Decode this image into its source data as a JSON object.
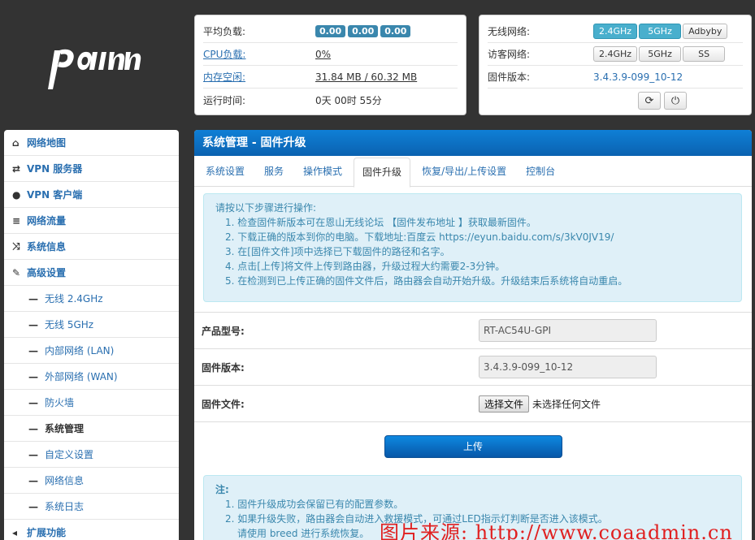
{
  "status": {
    "avg_load_label": "平均负载:",
    "avg_load_values": [
      "0.00",
      "0.00",
      "0.00"
    ],
    "cpu_label": "CPU负载:",
    "cpu_value": "0%",
    "mem_label": "内存空闲:",
    "mem_value": "31.84 MB / 60.32 MB",
    "uptime_label": "运行时间:",
    "uptime_value": "0天 00时 55分"
  },
  "network": {
    "wireless_label": "无线网络:",
    "wireless_buttons": [
      "2.4GHz",
      "5GHz",
      "Adbyby"
    ],
    "guest_label": "访客网络:",
    "guest_buttons": [
      "2.4GHz",
      "5GHz",
      "SS"
    ],
    "fw_label": "固件版本:",
    "fw_value": "3.4.3.9-099_10-12"
  },
  "sidebar": {
    "items": [
      {
        "label": "网络地图",
        "icon": "home-icon",
        "glyph": "⌂"
      },
      {
        "label": "VPN 服务器",
        "icon": "retweet-icon",
        "glyph": "⇄"
      },
      {
        "label": "VPN 客户端",
        "icon": "globe-icon",
        "glyph": "●"
      },
      {
        "label": "网络流量",
        "icon": "list-icon",
        "glyph": "≡"
      },
      {
        "label": "系统信息",
        "icon": "random-icon",
        "glyph": "⤨"
      },
      {
        "label": "高级设置",
        "icon": "wrench-icon",
        "glyph": "✎"
      }
    ],
    "sub_items": [
      "无线 2.4GHz",
      "无线 5GHz",
      "内部网络 (LAN)",
      "外部网络 (WAN)",
      "防火墙",
      "系统管理",
      "自定义设置",
      "网络信息",
      "系统日志"
    ],
    "last_item": {
      "label": "扩展功能",
      "icon": "share-icon",
      "glyph": "◂"
    }
  },
  "main": {
    "title": "系统管理 - 固件升级",
    "tabs": [
      "系统设置",
      "服务",
      "操作模式",
      "固件升级",
      "恢复/导出/上传设置",
      "控制台"
    ],
    "info_intro": "请按以下步骤进行操作:",
    "steps": [
      "1. 检查固件新版本可在恩山无线论坛 【固件发布地址 】获取最新固件。",
      "2. 下载正确的版本到你的电脑。下载地址:百度云 https://eyun.baidu.com/s/3kV0JV19/",
      "3. 在[固件文件]项中选择已下载固件的路径和名字。",
      "4. 点击[上传]将文件上传到路由器，升级过程大约需要2-3分钟。",
      "5. 在检测到已上传正确的固件文件后，路由器会自动开始升级。升级结束后系统将自动重启。"
    ],
    "model_label": "产品型号:",
    "model_value": "RT-AC54U-GPI",
    "fwver_label": "固件版本:",
    "fwver_value": "3.4.3.9-099_10-12",
    "file_label": "固件文件:",
    "choose_file": "选择文件",
    "no_file": "未选择任何文件",
    "upload": "上传",
    "note_title": "注:",
    "notes": [
      "1. 固件升级成功会保留已有的配置参数。",
      "2. 如果升级失败，路由器会自动进入救援模式，可通过LED指示灯判断是否进入该模式。"
    ],
    "note_cont": "请使用 breed 进行系统恢复。"
  },
  "watermark": "图片来源: http://www.coaadmin.cn"
}
